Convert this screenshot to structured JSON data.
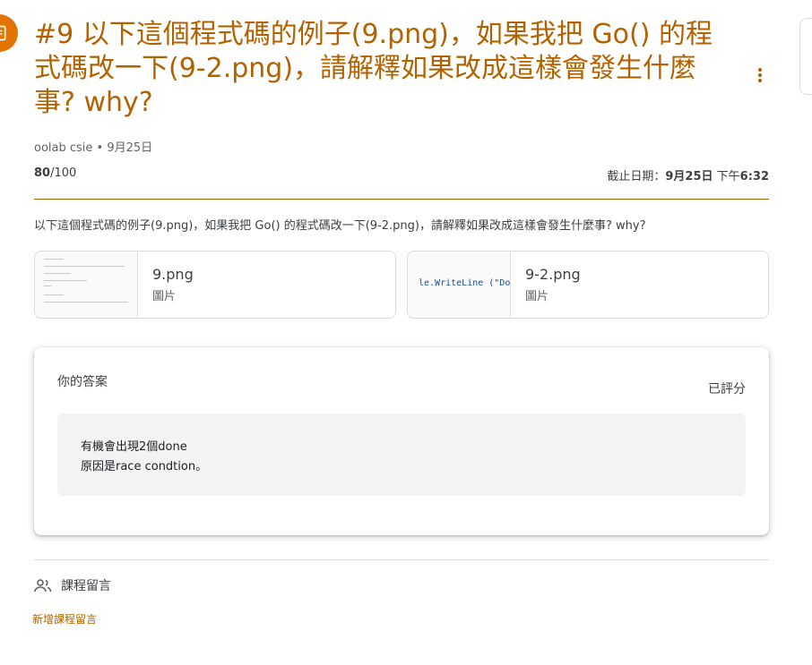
{
  "assignment": {
    "title": "#9 以下這個程式碼的例子(9.png)，如果我把 Go() 的程式碼改一下(9-2.png)，請解釋如果改成這樣會發生什麼事? why?",
    "author": "oolab csie",
    "posted_date": "9月25日",
    "points_earned": "80",
    "points_total": "/100",
    "due_label": "截止日期：",
    "due_date": "9月25日",
    "due_time_prefix": " 下午",
    "due_time": "6:32",
    "description": "以下這個程式碼的例子(9.png)，如果我把 Go() 的程式碼改一下(9-2.png)，請解釋如果改成這樣會發生什麼事? why?"
  },
  "attachments": [
    {
      "name": "9.png",
      "type": "圖片"
    },
    {
      "name": "9-2.png",
      "type": "圖片",
      "preview_text": "le.WriteLine (\"Dor"
    }
  ],
  "your_work": {
    "heading": "你的答案",
    "status": "已評分",
    "answer_lines": [
      "有機會出現2個done",
      "原因是race condtion。"
    ]
  },
  "class_comments": {
    "heading": "課程留言",
    "add_label": "新增課程留言"
  },
  "colors": {
    "accent": "#b26200",
    "icon_bg": "#e37400"
  },
  "icons": {
    "assignment": "assignment-icon",
    "more": "more-vert-icon",
    "people": "people-icon"
  }
}
